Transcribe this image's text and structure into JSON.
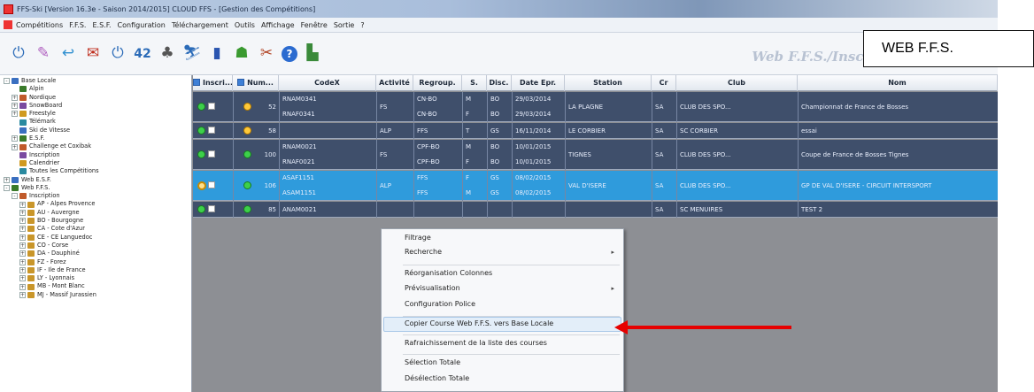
{
  "window": {
    "title": "FFS-Ski [Version 16.3e - Saison 2014/2015] CLOUD FFS - [Gestion des Compétitions]"
  },
  "menu": [
    "Compétitions",
    "F.F.S.",
    "E.S.F.",
    "Configuration",
    "Téléchargement",
    "Outils",
    "Affichage",
    "Fenêtre",
    "Sortie",
    "?"
  ],
  "toolbar": {
    "icons": [
      "power-icon",
      "pencil-icon",
      "undo-icon",
      "mail-icon",
      "power-alt-icon",
      "race-number-icon",
      "group-icon",
      "ski-icon",
      "book-icon",
      "user-icon",
      "tools-icon",
      "help-icon",
      "exit-icon"
    ],
    "banner": "Web F.F.S./Inscription/SA - Sav"
  },
  "callout": {
    "label": "WEB F.F.S."
  },
  "tree": [
    {
      "label": "Base Locale",
      "level": 0,
      "expander": "-"
    },
    {
      "label": "Alpin",
      "level": 1,
      "expander": ""
    },
    {
      "label": "Nordique",
      "level": 1,
      "expander": "+"
    },
    {
      "label": "SnowBoard",
      "level": 1,
      "expander": "+"
    },
    {
      "label": "Freestyle",
      "level": 1,
      "expander": "+"
    },
    {
      "label": "Télémark",
      "level": 1,
      "expander": ""
    },
    {
      "label": "Ski de Vitesse",
      "level": 1,
      "expander": ""
    },
    {
      "label": "E.S.F.",
      "level": 1,
      "expander": "+"
    },
    {
      "label": "Challenge et Coxibak",
      "level": 1,
      "expander": "+"
    },
    {
      "label": "Inscription",
      "level": 1,
      "expander": ""
    },
    {
      "label": "Calendrier",
      "level": 1,
      "expander": ""
    },
    {
      "label": "Toutes les Compétitions",
      "level": 1,
      "expander": ""
    },
    {
      "label": "Web E.S.F.",
      "level": 0,
      "expander": "+"
    },
    {
      "label": "Web F.F.S.",
      "level": 0,
      "expander": "-"
    },
    {
      "label": "Inscription",
      "level": 1,
      "expander": "-"
    },
    {
      "label": "AP - Alpes Provence",
      "level": 2,
      "expander": "+"
    },
    {
      "label": "AU - Auvergne",
      "level": 2,
      "expander": "+"
    },
    {
      "label": "BO - Bourgogne",
      "level": 2,
      "expander": "+"
    },
    {
      "label": "CA - Cote d'Azur",
      "level": 2,
      "expander": "+"
    },
    {
      "label": "CE - CE Languedoc",
      "level": 2,
      "expander": "+"
    },
    {
      "label": "CO - Corse",
      "level": 2,
      "expander": "+"
    },
    {
      "label": "DA - Dauphiné",
      "level": 2,
      "expander": "+"
    },
    {
      "label": "FZ - Forez",
      "level": 2,
      "expander": "+"
    },
    {
      "label": "IF - Ile de France",
      "level": 2,
      "expander": "+"
    },
    {
      "label": "LY - Lyonnais",
      "level": 2,
      "expander": "+"
    },
    {
      "label": "MB - Mont Blanc",
      "level": 2,
      "expander": "+"
    },
    {
      "label": "MJ - Massif Jurassien",
      "level": 2,
      "expander": "+"
    }
  ],
  "columns": [
    "Inscri...",
    "Num...",
    "CodeX",
    "Activité",
    "Regroup.",
    "S.",
    "Disc.",
    "Date Epr.",
    "Station",
    "Cr",
    "Club",
    "Nom"
  ],
  "rows": [
    {
      "status": "warn",
      "num": "52",
      "activite": "FS",
      "selected": false,
      "lines": [
        {
          "codex": "RNAM0341",
          "regroup": "CN-BO",
          "sexe": "M",
          "disc": "BO",
          "date": "29/03/2014"
        },
        {
          "codex": "RNAF0341",
          "regroup": "CN-BO",
          "sexe": "F",
          "disc": "BO",
          "date": "29/03/2014"
        }
      ],
      "station": "LA PLAGNE",
      "cr": "SA",
      "club": "CLUB DES SPO...",
      "nom": "Championnat de France de Bosses"
    },
    {
      "status": "warn",
      "num": "58",
      "activite": "ALP",
      "selected": false,
      "lines": [
        {
          "codex": "",
          "regroup": "FFS",
          "sexe": "T",
          "disc": "GS",
          "date": "16/11/2014"
        }
      ],
      "station": "LE CORBIER",
      "cr": "SA",
      "club": "SC CORBIER",
      "nom": "essai"
    },
    {
      "status": "ok",
      "num": "100",
      "activite": "FS",
      "selected": false,
      "lines": [
        {
          "codex": "RNAM0021",
          "regroup": "CPF-BO",
          "sexe": "M",
          "disc": "BO",
          "date": "10/01/2015"
        },
        {
          "codex": "RNAF0021",
          "regroup": "CPF-BO",
          "sexe": "F",
          "disc": "BO",
          "date": "10/01/2015"
        }
      ],
      "station": "TIGNES",
      "cr": "SA",
      "club": "CLUB DES SPO...",
      "nom": "Coupe de France de Bosses Tignes"
    },
    {
      "status": "ok",
      "num": "106",
      "activite": "ALP",
      "selected": true,
      "lines": [
        {
          "codex": "ASAF1151",
          "regroup": "FFS",
          "sexe": "F",
          "disc": "GS",
          "date": "08/02/2015"
        },
        {
          "codex": "ASAM1151",
          "regroup": "FFS",
          "sexe": "M",
          "disc": "GS",
          "date": "08/02/2015"
        }
      ],
      "station": "VAL D'ISERE",
      "cr": "SA",
      "club": "CLUB DES SPO...",
      "nom": "GP DE VAL D'ISERE - CIRCUIT INTERSPORT"
    },
    {
      "status": "ok",
      "num": "85",
      "activite": "",
      "selected": false,
      "lines": [
        {
          "codex": "ANAM0021",
          "regroup": "",
          "sexe": "",
          "disc": "",
          "date": ""
        }
      ],
      "station": "",
      "cr": "SA",
      "club": "SC MENUIRES",
      "nom": "TEST 2"
    }
  ],
  "context_menu": {
    "items": [
      {
        "label": "Filtrage",
        "submenu": false
      },
      {
        "label": "Recherche",
        "submenu": true
      },
      {
        "label": "Réorganisation Colonnes",
        "submenu": false
      },
      {
        "label": "Prévisualisation",
        "submenu": true
      },
      {
        "label": "Configuration Police",
        "submenu": false
      },
      {
        "label": "Copier Course Web F.F.S. vers Base Locale",
        "submenu": false,
        "highlighted": true
      },
      {
        "label": "Rafraichissement de la liste des courses",
        "submenu": false
      },
      {
        "label": "Sélection Totale",
        "submenu": false
      },
      {
        "label": "Désélection Totale",
        "submenu": false
      }
    ]
  },
  "colors": {
    "row_bg": "#3f4f6b",
    "row_selected_bg": "#2f9bdc",
    "arrow": "#e60000"
  }
}
